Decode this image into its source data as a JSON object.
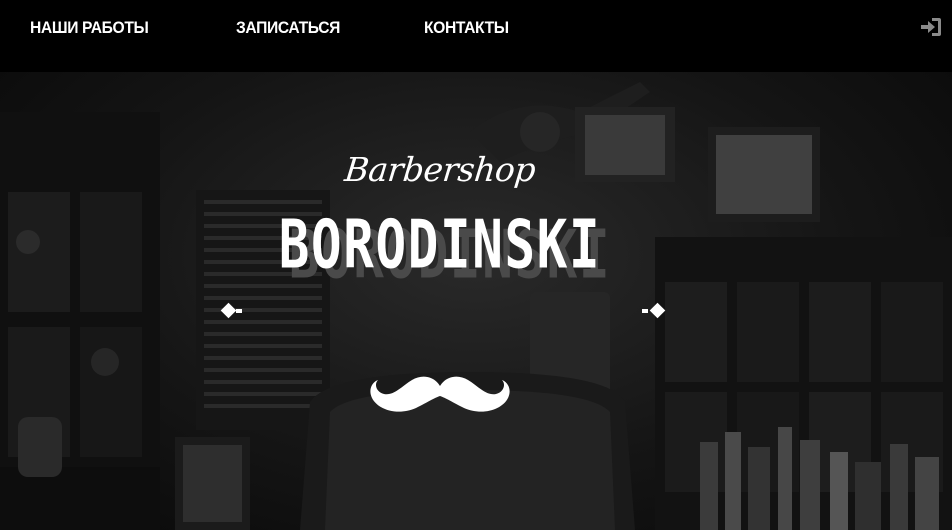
{
  "nav": {
    "items": [
      {
        "label": "НАШИ РАБОТЫ"
      },
      {
        "label": "ЗАПИСАТЬСЯ"
      },
      {
        "label": "КОНТАКТЫ"
      }
    ],
    "login_icon": "sign-in-icon"
  },
  "hero": {
    "logo_script": "Barbershop",
    "logo_name": "BORODINSKI",
    "logo_emblem": "mustache-icon"
  },
  "colors": {
    "nav_background": "#000000",
    "nav_text": "#ffffff",
    "logo_text": "#ffffff",
    "login_icon": "#8a8a8a"
  }
}
